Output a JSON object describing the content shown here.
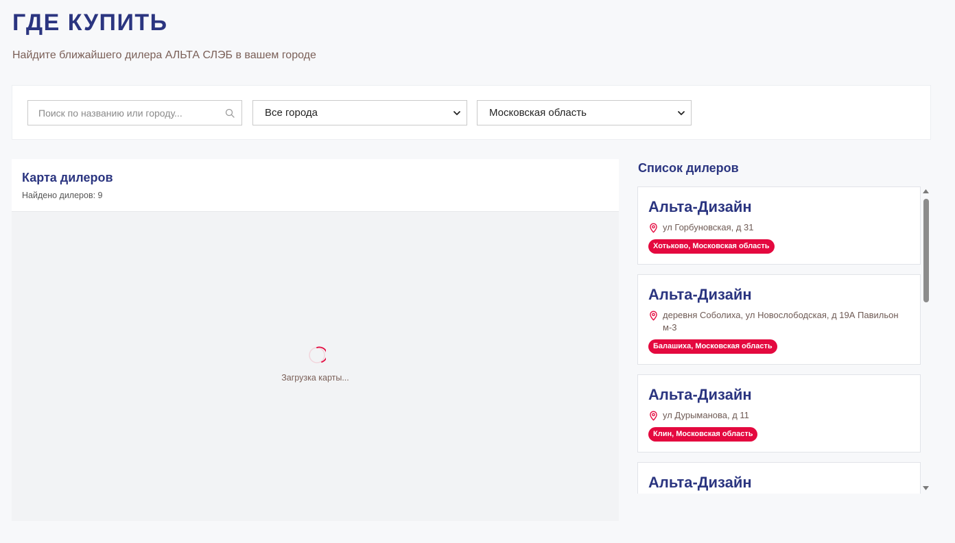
{
  "header": {
    "title": "ГДЕ КУПИТЬ",
    "subtitle": "Найдите ближайшего дилера АЛЬТА СЛЭБ в вашем городе"
  },
  "filters": {
    "search_placeholder": "Поиск по названию или городу...",
    "search_icon": "search-icon",
    "city_select": "Все города",
    "region_select": "Московская область"
  },
  "map": {
    "title": "Карта дилеров",
    "count_text": "Найдено дилеров: 9",
    "loading_text": "Загрузка карты..."
  },
  "dealers": {
    "title": "Список дилеров",
    "items": [
      {
        "name": "Альта-Дизайн",
        "address": "ул Горбуновская, д 31",
        "location": "Хотьково, Московская область"
      },
      {
        "name": "Альта-Дизайн",
        "address": "деревня Соболиха, ул Новослободская, д 19А Павильон м-3",
        "location": "Балашиха, Московская область"
      },
      {
        "name": "Альта-Дизайн",
        "address": "ул Дурыманова, д 11",
        "location": "Клин, Московская область"
      },
      {
        "name": "Альта-Дизайн"
      }
    ]
  },
  "colors": {
    "brand_blue": "#2b3580",
    "accent_red": "#e4093f",
    "muted_brown": "#7a5f57"
  }
}
